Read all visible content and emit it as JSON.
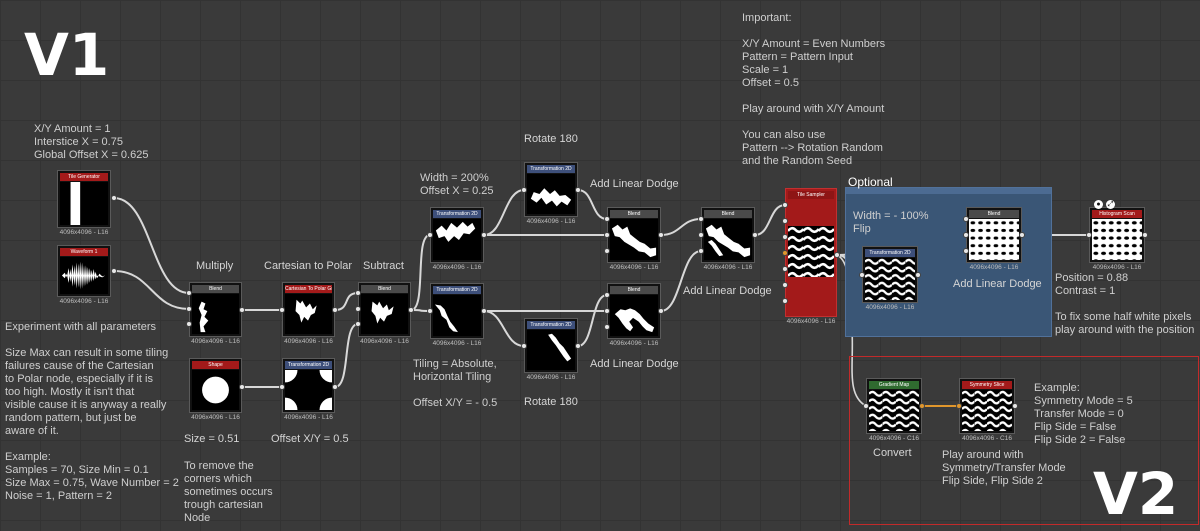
{
  "titles": {
    "v1": "V1",
    "v2": "V2"
  },
  "colors": {
    "wire": "#d8d8d8",
    "wire_orange": "#e0962c",
    "frame_optional": "#3a5676",
    "frame_v2": "#c22a2a"
  },
  "notes": {
    "tile_params": "X/Y Amount = 1\nInterstice X = 0.75\nGlobal Offset X = 0.625",
    "important": "Important:\n\nX/Y Amount = Even Numbers\nPattern = Pattern Input\nScale = 1\nOffset = 0.5\n\nPlay around with X/Y Amount\n\nYou can also use\nPattern --> Rotation Random\nand the Random Seed",
    "experiment": "Experiment with all parameters\n\nSize Max can result in some tiling\nfailures cause of the Cartesian\nto Polar node, especially if it is\ntoo high. Mostly it isn't that\nvisible cause it is anyway a really\nrandom pattern, but just be\naware of it.\n\nExample:\nSamples = 70, Size Min = 0.1\nSize Max = 0.75, Wave Number = 2\nNoise = 1, Pattern = 2",
    "remove_corners": "To remove the\ncorners which\nsometimes occurs\ntrough cartesian\nNode",
    "tiling": "Tiling = Absolute,\nHorizontal Tiling\n\nOffset X/Y = - 0.5",
    "width_offset": "Width = 200%\nOffset X = 0.25",
    "width_flip": "Width = - 100%\nFlip",
    "position": "Position = 0.88\nContrast = 1\n\nTo fix some half white pixels\nplay around with the position",
    "example_v2": "Example:\nSymmetry Mode = 5\nTransfer Mode = 0\nFlip Side = False\nFlip Side 2 = False",
    "play_v2": "Play around with\nSymmetry/Transfer Mode\nFlip Side, Flip Side 2"
  },
  "labels": {
    "multiply": "Multiply",
    "cartesian": "Cartesian to Polar",
    "subtract": "Subtract",
    "rotate_top": "Rotate 180",
    "rotate_bottom": "Rotate 180",
    "add_linear_dodge_top": "Add Linear Dodge",
    "add_linear_dodge_bottom": "Add Linear Dodge",
    "add_linear_dodge_mid": "Add Linear Dodge",
    "add_linear_dodge_optional": "Add Linear Dodge",
    "size": "Size = 0.51",
    "offset_xy": "Offset X/Y = 0.5",
    "optional": "Optional",
    "convert": "Convert"
  },
  "nodes": {
    "tile_generator": {
      "title": "Tile Generator",
      "res": "4096x4096 - L16"
    },
    "waveform": {
      "title": "Waveform 1",
      "res": "4096x4096 - L16"
    },
    "blend_multiply": {
      "title": "Blend",
      "res": "4096x4096 - L16"
    },
    "shape": {
      "title": "Shape",
      "res": "4096x4096 - L16"
    },
    "cart_polar": {
      "title": "Cartesian To Polar Gra...",
      "res": "4096x4096 - L16"
    },
    "transform_corners": {
      "title": "Transformation 2D",
      "res": "4096x4096 - L16"
    },
    "blend_subtract": {
      "title": "Blend",
      "res": "4096x4096 - L16"
    },
    "transform_top": {
      "title": "Transformation 2D",
      "res": "4096x4096 - L16"
    },
    "transform_bottom": {
      "title": "Transformation 2D",
      "res": "4096x4096 - L16"
    },
    "transform_rot_top": {
      "title": "Transformation 2D",
      "res": "4096x4096 - L16"
    },
    "transform_rot_bottom": {
      "title": "Transformation 2D",
      "res": "4096x4096 - L16"
    },
    "blend_top": {
      "title": "Blend",
      "res": "4096x4096 - L16"
    },
    "blend_bottom": {
      "title": "Blend",
      "res": "4096x4096 - L16"
    },
    "blend_mid": {
      "title": "Blend",
      "res": "4096x4096 - L16"
    },
    "tile_sampler": {
      "title": "Tile Sampler",
      "res": "4096x4096 - L16"
    },
    "transform_opt": {
      "title": "Transformation 2D",
      "res": "4096x4096 - L16"
    },
    "blend_opt": {
      "title": "Blend",
      "res": "4096x4096 - L16"
    },
    "histogram_scan": {
      "title": "Histogram Scan",
      "res": "4096x4096 - L16"
    },
    "gradient_map": {
      "title": "Gradient Map",
      "res": "4096x4096 - C16"
    },
    "symmetry_slice": {
      "title": "Symmetry Slice",
      "res": "4096x4096 - C16"
    }
  }
}
